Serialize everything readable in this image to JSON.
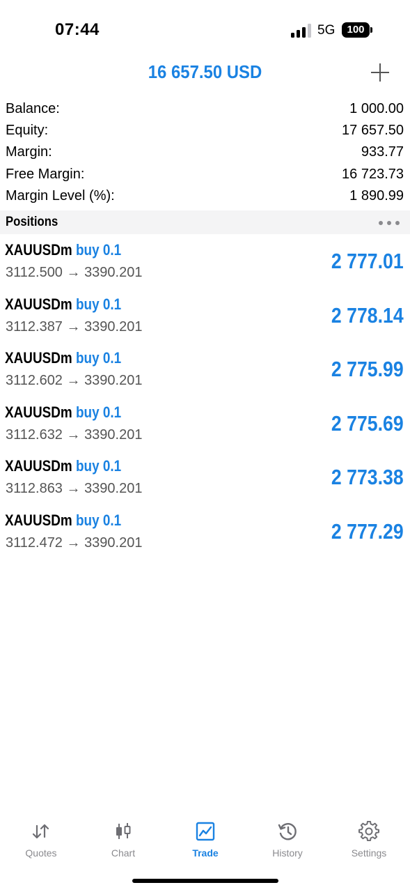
{
  "status_bar": {
    "time": "07:44",
    "network": "5G",
    "battery": "100"
  },
  "header": {
    "total": "16 657.50 USD"
  },
  "summary": [
    {
      "label": "Balance:",
      "value": "1 000.00"
    },
    {
      "label": "Equity:",
      "value": "17 657.50"
    },
    {
      "label": "Margin:",
      "value": "933.77"
    },
    {
      "label": "Free Margin:",
      "value": "16 723.73"
    },
    {
      "label": "Margin Level (%):",
      "value": "1 890.99"
    }
  ],
  "positions": {
    "title": "Positions",
    "items": [
      {
        "symbol": "XAUUSDm",
        "type": "buy 0.1",
        "open_price": "3112.500",
        "arrow": "→",
        "current_price": "3390.201",
        "profit": "2 777.01"
      },
      {
        "symbol": "XAUUSDm",
        "type": "buy 0.1",
        "open_price": "3112.387",
        "arrow": "→",
        "current_price": "3390.201",
        "profit": "2 778.14"
      },
      {
        "symbol": "XAUUSDm",
        "type": "buy 0.1",
        "open_price": "3112.602",
        "arrow": "→",
        "current_price": "3390.201",
        "profit": "2 775.99"
      },
      {
        "symbol": "XAUUSDm",
        "type": "buy 0.1",
        "open_price": "3112.632",
        "arrow": "→",
        "current_price": "3390.201",
        "profit": "2 775.69"
      },
      {
        "symbol": "XAUUSDm",
        "type": "buy 0.1",
        "open_price": "3112.863",
        "arrow": "→",
        "current_price": "3390.201",
        "profit": "2 773.38"
      },
      {
        "symbol": "XAUUSDm",
        "type": "buy 0.1",
        "open_price": "3112.472",
        "arrow": "→",
        "current_price": "3390.201",
        "profit": "2 777.29"
      }
    ]
  },
  "tabs": [
    {
      "label": "Quotes",
      "icon": "quotes-icon"
    },
    {
      "label": "Chart",
      "icon": "chart-icon"
    },
    {
      "label": "Trade",
      "icon": "trade-icon"
    },
    {
      "label": "History",
      "icon": "history-icon"
    },
    {
      "label": "Settings",
      "icon": "settings-icon"
    }
  ],
  "colors": {
    "accent": "#1a82e2",
    "secondary_text": "#555555",
    "tab_inactive": "#8a8a8e",
    "section_bg": "#f4f4f5"
  }
}
